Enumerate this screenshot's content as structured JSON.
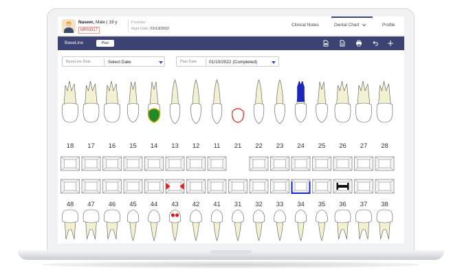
{
  "patient": {
    "name": "Naseer,",
    "gender_age": "Male | 19 y",
    "mrn": "MRNO17"
  },
  "provider": {
    "label": "Provider:",
    "appt_label": "Appt Date:",
    "appt_date": "01/13/2022"
  },
  "nav": {
    "clinical_notes": "Clinical Notes",
    "dental_chart": "Dental Chart",
    "profile": "Profile"
  },
  "toolbar": {
    "baseline_label": "BaseLine",
    "plan_button": "Plan",
    "icons": [
      "pdf-icon",
      "document-icon",
      "print-icon",
      "undo-icon",
      "add-icon"
    ]
  },
  "filters": {
    "baseline_date_label": "BaseLine Date",
    "baseline_date_value": "Select Date",
    "plan_date_label": "Plan Date",
    "plan_date_value": "01/10/2022 (Completed)"
  },
  "colors": {
    "accent": "#3c4272",
    "tooth_fill": "#f3f1d2",
    "crown_fill": "#ffffff",
    "caries_green": "#1f8a2a",
    "red_marker": "#e01b1b",
    "blue_marker": "#1a26c4"
  },
  "upper_teeth": [
    {
      "number": "18",
      "condition": ""
    },
    {
      "number": "17",
      "condition": ""
    },
    {
      "number": "16",
      "condition": ""
    },
    {
      "number": "15",
      "condition": ""
    },
    {
      "number": "14",
      "condition": "crown-filled-green"
    },
    {
      "number": "13",
      "condition": ""
    },
    {
      "number": "12",
      "condition": ""
    },
    {
      "number": "11",
      "condition": ""
    },
    {
      "number": "21",
      "condition": "missing-outlined-red"
    },
    {
      "number": "22",
      "condition": ""
    },
    {
      "number": "23",
      "condition": ""
    },
    {
      "number": "24",
      "condition": "root-canal-blue"
    },
    {
      "number": "25",
      "condition": ""
    },
    {
      "number": "26",
      "condition": ""
    },
    {
      "number": "27",
      "condition": ""
    },
    {
      "number": "28",
      "condition": ""
    }
  ],
  "lower_teeth": [
    {
      "number": "48",
      "condition": ""
    },
    {
      "number": "47",
      "condition": ""
    },
    {
      "number": "46",
      "condition": ""
    },
    {
      "number": "45",
      "condition": ""
    },
    {
      "number": "44",
      "condition": ""
    },
    {
      "number": "43",
      "condition": "red-marks"
    },
    {
      "number": "42",
      "condition": ""
    },
    {
      "number": "41",
      "condition": ""
    },
    {
      "number": "31",
      "condition": ""
    },
    {
      "number": "32",
      "condition": ""
    },
    {
      "number": "33",
      "condition": ""
    },
    {
      "number": "34",
      "condition": "blue-restoration"
    },
    {
      "number": "35",
      "condition": ""
    },
    {
      "number": "36",
      "condition": "black-bridge"
    },
    {
      "number": "37",
      "condition": ""
    },
    {
      "number": "38",
      "condition": ""
    }
  ]
}
